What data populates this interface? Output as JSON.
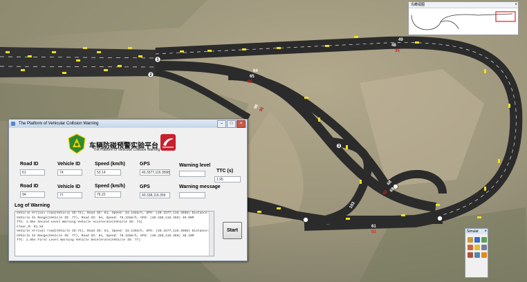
{
  "map": {
    "road_labels_white": [
      "49",
      "48",
      "64",
      "65",
      "96",
      "68",
      "63",
      "61"
    ],
    "road_labels_red": [
      "35",
      "95",
      "96",
      "62",
      "51"
    ],
    "marker_labels": [
      "1",
      "2",
      "3",
      "4",
      "5",
      "6",
      "7",
      "8",
      "9",
      "10",
      "11"
    ],
    "segment_label_103": "103"
  },
  "minimap": {
    "title": "鸟瞰视图",
    "close": "×"
  },
  "dialog": {
    "title": "The Platform of Vehicular Collision Warning",
    "window_buttons": {
      "minimize": "–",
      "maximize": "□",
      "close": "×"
    },
    "title_cn": "车辆防碰预警实验平台",
    "title_en": "The Platform of Vehicular Collision Warning",
    "row1": {
      "road_id_label": "Road ID",
      "road_id_value": "61",
      "vehicle_id_label": "Vehicle ID",
      "vehicle_id_value": "74",
      "speed_label": "Speed (km/h)",
      "speed_value": "53.14",
      "gps_label": "GPS",
      "gps_value": "40.3377,116.3598",
      "warning_level_label": "Warning level",
      "warning_level_value": ""
    },
    "ttc_label": "TTC (s)",
    "ttc_value": "1.95",
    "row2": {
      "road_id_label": "Road ID",
      "road_id_value": "94",
      "vehicle_id_label": "Vehicle ID",
      "vehicle_id_value": "77",
      "speed_label": "Speed (km/h)",
      "speed_value": "76.22",
      "gps_label": "GPS",
      "gps_value": "40.338,116.359",
      "warning_message_label": "Warning message",
      "warning_message_value": ""
    },
    "log_label": "Log of Warning",
    "log_lines": [
      "Vehicle Arrival road(Vehicle ID:74), Road ID: 61, Speed: 53.14km/h, GPS: (40.3377,116.3598) Distance: 37.98M",
      "Vehicle In Range(Vehicle ID: 77), Road ID: 94, Speed: 76.22km/h, GPS: (40.338,116.359) 40.00M",
      "TTC: 1.95s      Second Level Warning      Vehicle Accelerate(Vehicle ID: 74)",
      "Clear_M: 61.54",
      "Vehicle Arrival road(Vehicle ID:74), Road ID: 61, Speed: 53.14km/h, GPS: (40.3377,116.3598) Distance: 35.20M",
      "Vehicle In Range(Vehicle ID: 77), Road ID: 94, Speed: 76.22km/h, GPS: (40.338,116.359) 38.10M",
      "TTC: 1.86s      First Level Warning      Vehicle Decelerate(Vehicle ID: 77)"
    ],
    "start_button": "Start"
  },
  "simulator": {
    "title": "Simulat",
    "close": "×"
  },
  "colors": {
    "road": "#2b2b2b",
    "lane_line": "#e8e8e8",
    "vehicle": "#f0e020",
    "label_white": "#ffffff",
    "label_red": "#d42020",
    "logo_green": "#2d8a2d",
    "logo_red": "#c8202c"
  }
}
